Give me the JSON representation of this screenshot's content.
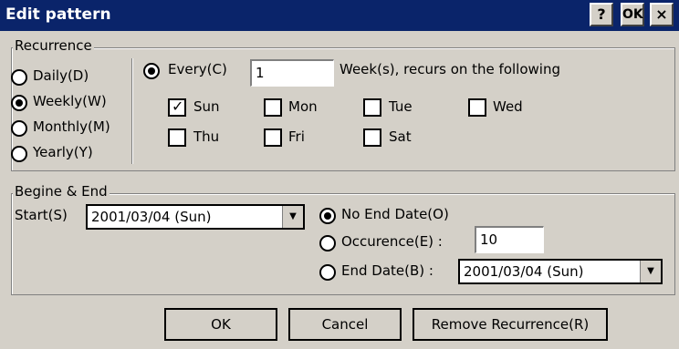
{
  "window": {
    "title": "Edit pattern",
    "help_label": "?",
    "ok_label": "OK",
    "close_label": "×"
  },
  "recurrence": {
    "legend": "Recurrence",
    "options": [
      {
        "label": "Daily(D)",
        "selected": false
      },
      {
        "label": "Weekly(W)",
        "selected": true
      },
      {
        "label": "Monthly(M)",
        "selected": false
      },
      {
        "label": "Yearly(Y)",
        "selected": false
      }
    ],
    "every_label": "Every(C)",
    "every_value": "1",
    "suffix": "Week(s), recurs on the following",
    "days": [
      {
        "label": "Sun",
        "checked": true
      },
      {
        "label": "Mon",
        "checked": false
      },
      {
        "label": "Tue",
        "checked": false
      },
      {
        "label": "Wed",
        "checked": false
      },
      {
        "label": "Thu",
        "checked": false
      },
      {
        "label": "Fri",
        "checked": false
      },
      {
        "label": "Sat",
        "checked": false
      }
    ]
  },
  "range": {
    "legend": "Begine & End",
    "start_label": "Start(S)",
    "start_value": "2001/03/04 (Sun)",
    "no_end_label": "No End Date(O)",
    "occurence_label": "Occurence(E) :",
    "occurence_value": "10",
    "end_date_label": "End Date(B) :",
    "end_date_value": "2001/03/04 (Sun)"
  },
  "buttons": {
    "ok": "OK",
    "cancel": "Cancel",
    "remove": "Remove Recurrence(R)"
  }
}
